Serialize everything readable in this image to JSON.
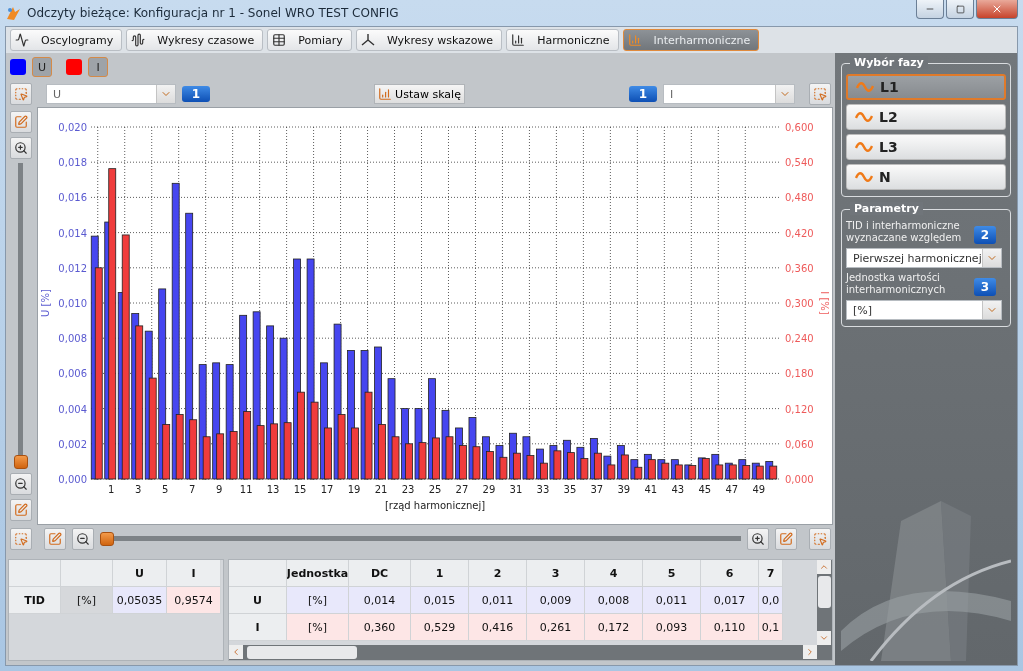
{
  "window": {
    "title": "Odczyty bieżące: Konfiguracja nr 1 - Sonel WRO TEST CONFIG"
  },
  "tabs": [
    {
      "label": "Oscylogramy",
      "selected": false
    },
    {
      "label": "Wykresy czasowe",
      "selected": false
    },
    {
      "label": "Pomiary",
      "selected": false
    },
    {
      "label": "Wykresy wskazowe",
      "selected": false
    },
    {
      "label": "Harmoniczne",
      "selected": false
    },
    {
      "label": "Interharmoniczne",
      "selected": true
    }
  ],
  "legend": [
    {
      "color": "#0000ff"
    },
    {
      "color": "#ff0000"
    }
  ],
  "toolbar": {
    "left_select": {
      "value": "U"
    },
    "left_badge": "1",
    "scale_button": "Ustaw skalę",
    "right_badge": "1",
    "right_select": {
      "value": "I"
    }
  },
  "vertical_zoom": {
    "level": 0
  },
  "horizontal_zoom": {
    "level": 0
  },
  "chart": {
    "chart_data": {
      "type": "bar",
      "xlabel": "[rząd harmonicznej]",
      "ylabel": "U [%]",
      "y2label": "I [%]",
      "x": [
        0,
        1,
        2,
        3,
        4,
        5,
        6,
        7,
        8,
        9,
        10,
        11,
        12,
        13,
        14,
        15,
        16,
        17,
        18,
        19,
        20,
        21,
        22,
        23,
        24,
        25,
        26,
        27,
        28,
        29,
        30,
        31,
        32,
        33,
        34,
        35,
        36,
        37,
        38,
        39,
        40,
        41,
        42,
        43,
        44,
        45,
        46,
        47,
        48,
        49,
        50
      ],
      "xlim": [
        -0.5,
        50.5
      ],
      "grid": true,
      "xticks": [
        1,
        3,
        5,
        7,
        9,
        11,
        13,
        15,
        17,
        19,
        21,
        23,
        25,
        27,
        29,
        31,
        33,
        35,
        37,
        39,
        41,
        43,
        45,
        47,
        49
      ],
      "ylim": [
        0,
        0.02
      ],
      "yticks": [
        {
          "value": 0,
          "label": "0,000"
        },
        {
          "value": 0.002,
          "label": "0,002"
        },
        {
          "value": 0.004,
          "label": "0,004"
        },
        {
          "value": 0.006,
          "label": "0,006"
        },
        {
          "value": 0.008,
          "label": "0,008"
        },
        {
          "value": 0.01,
          "label": "0,010"
        },
        {
          "value": 0.012,
          "label": "0,012"
        },
        {
          "value": 0.014,
          "label": "0,014"
        },
        {
          "value": 0.016,
          "label": "0,016"
        },
        {
          "value": 0.018,
          "label": "0,018"
        },
        {
          "value": 0.02,
          "label": "0,020"
        }
      ],
      "y2lim": [
        0,
        0.6
      ],
      "y2ticks": [
        {
          "value": 0,
          "label": "0,000"
        },
        {
          "value": 0.06,
          "label": "0,060"
        },
        {
          "value": 0.12,
          "label": "0,120"
        },
        {
          "value": 0.18,
          "label": "0,180"
        },
        {
          "value": 0.24,
          "label": "0,240"
        },
        {
          "value": 0.3,
          "label": "0,300"
        },
        {
          "value": 0.36,
          "label": "0,360"
        },
        {
          "value": 0.42,
          "label": "0,420"
        },
        {
          "value": 0.48,
          "label": "0,480"
        },
        {
          "value": 0.54,
          "label": "0,540"
        },
        {
          "value": 0.6,
          "label": "0,600"
        }
      ],
      "series": [
        {
          "name": "U",
          "color": "#4646f0",
          "values": [
            0.0138,
            0.0146,
            0.0106,
            0.0094,
            0.0084,
            0.0108,
            0.0168,
            0.0151,
            0.0065,
            0.0066,
            0.0065,
            0.0093,
            0.0095,
            0.0087,
            0.008,
            0.0125,
            0.0125,
            0.0066,
            0.0088,
            0.0073,
            0.0073,
            0.0075,
            0.0057,
            0.004,
            0.004,
            0.0057,
            0.0039,
            0.0029,
            0.0035,
            0.0024,
            0.0019,
            0.0026,
            0.0024,
            0.0017,
            0.0019,
            0.0022,
            0.0018,
            0.0023,
            0.0013,
            0.0019,
            0.0011,
            0.0014,
            0.0011,
            0.0011,
            0.0008,
            0.0012,
            0.0014,
            0.0009,
            0.0011,
            0.0009,
            0.001
          ]
        },
        {
          "name": "I",
          "color": "#f03c3c",
          "axis": "y2",
          "values": [
            0.36,
            0.529,
            0.416,
            0.261,
            0.172,
            0.093,
            0.11,
            0.101,
            0.072,
            0.077,
            0.081,
            0.115,
            0.091,
            0.094,
            0.096,
            0.148,
            0.131,
            0.087,
            0.11,
            0.087,
            0.148,
            0.093,
            0.072,
            0.06,
            0.062,
            0.07,
            0.072,
            0.057,
            0.055,
            0.047,
            0.037,
            0.044,
            0.04,
            0.027,
            0.048,
            0.045,
            0.035,
            0.044,
            0.024,
            0.041,
            0.02,
            0.033,
            0.027,
            0.024,
            0.023,
            0.035,
            0.024,
            0.024,
            0.023,
            0.022,
            0.022
          ]
        }
      ]
    }
  },
  "phase_panel": {
    "title": "Wybór fazy",
    "phases": [
      {
        "label": "L1",
        "selected": true
      },
      {
        "label": "L2",
        "selected": false
      },
      {
        "label": "L3",
        "selected": false
      },
      {
        "label": "N",
        "selected": false
      }
    ]
  },
  "parameters": {
    "title": "Parametry",
    "fields": [
      {
        "label": "TID i interharmoniczne wyznaczane względem",
        "badge": "2",
        "value": "Pierwszej harmonicznej"
      },
      {
        "label": "Jednostka wartości interharmonicznych",
        "badge": "3",
        "value": "[%]"
      }
    ]
  },
  "tid_table": {
    "columns": [
      "U",
      "I"
    ],
    "rows": [
      {
        "label": "TID",
        "unit": "[%]",
        "values": [
          {
            "text": "0,05035",
            "color": "#e8e8fb"
          },
          {
            "text": "0,9574",
            "color": "#fde6e6"
          }
        ]
      }
    ]
  },
  "harmonics_table": {
    "columns": [
      "Jednostka",
      "DC",
      "1",
      "2",
      "3",
      "4",
      "5",
      "6",
      "7"
    ],
    "rows": [
      {
        "label": "U",
        "color": "#e8e8fb",
        "cells": [
          "[%]",
          "0,014",
          "0,015",
          "0,011",
          "0,009",
          "0,008",
          "0,011",
          "0,017",
          "0,0"
        ]
      },
      {
        "label": "I",
        "color": "#fde6e6",
        "cells": [
          "[%]",
          "0,360",
          "0,529",
          "0,416",
          "0,261",
          "0,172",
          "0,093",
          "0,110",
          "0,1"
        ]
      }
    ]
  }
}
